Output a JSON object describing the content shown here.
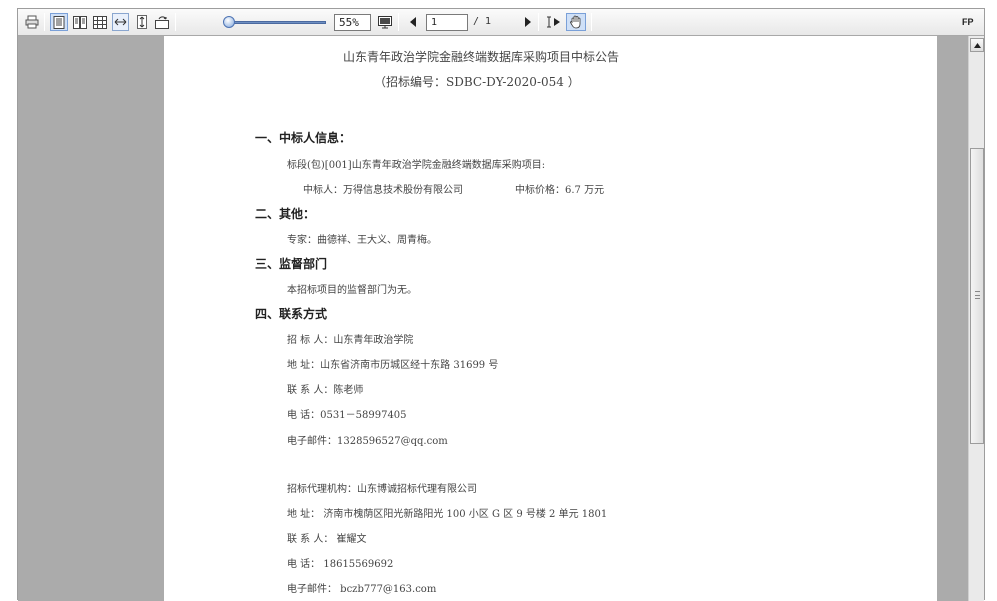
{
  "toolbar": {
    "zoom_value": "55%",
    "page_input": "1",
    "page_total": "/ 1",
    "fp_label": "FP"
  },
  "document": {
    "title": "山东青年政治学院金融终端数据库采购项目中标公告",
    "subtitle": "（招标编号：SDBC-DY-2020-054   ）",
    "section1_heading": "一、中标人信息：",
    "section1_line1": "标段(包)[001]山东青年政治学院金融终端数据库采购项目:",
    "section1_winner": "中标人：万得信息技术股份有限公司",
    "section1_price": "中标价格：6.7 万元",
    "section2_heading": "二、其他：",
    "section2_line1": "专家：曲德祥、王大义、周青梅。",
    "section3_heading": "三、监督部门",
    "section3_line1": "本招标项目的监督部门为无。",
    "section4_heading": "四、联系方式",
    "contact1_tenderer": "招 标 人：山东青年政治学院",
    "contact1_address": "地    址：山东省济南市历城区经十东路 31699 号",
    "contact1_person": "联 系 人：陈老师",
    "contact1_phone": "电    话：0531－58997405",
    "contact1_email": "电子邮件：1328596527@qq.com",
    "agency_name": "招标代理机构：山东博诚招标代理有限公司",
    "agency_address": "地    址：  济南市槐荫区阳光新路阳光 100 小区 G 区 9 号楼 2 单元 1801",
    "agency_person": "联 系 人：  崔耀文",
    "agency_phone": "电    话：  18615569692",
    "agency_email": "电子邮件：  bczb777@163.com"
  }
}
